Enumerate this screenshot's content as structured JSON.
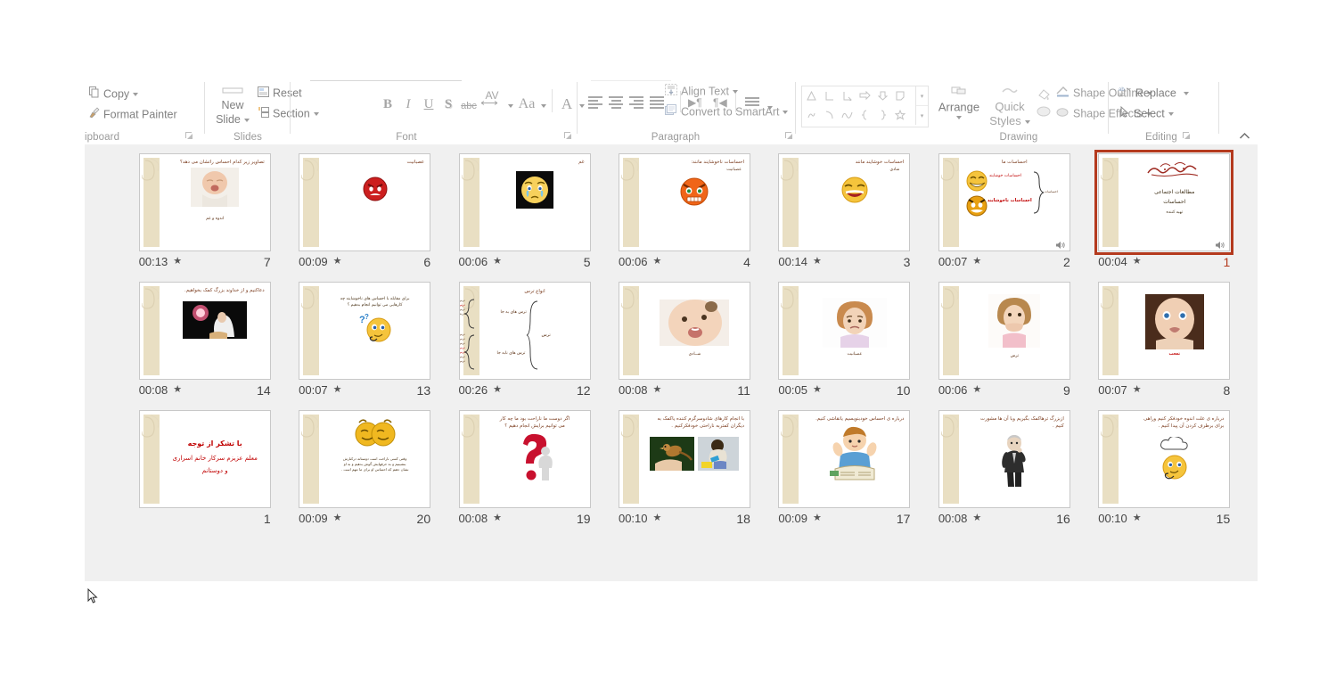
{
  "app": {
    "name": "PowerPoint Slide Sorter"
  },
  "ribbon": {
    "groups": [
      {
        "id": "clipboard",
        "label": "ipboard",
        "items": [
          {
            "name": "copy-button",
            "label": "Copy",
            "icon": "copy-icon",
            "caret": true
          },
          {
            "name": "format-painter-button",
            "label": "Format Painter",
            "icon": "format-painter-icon",
            "caret": false
          }
        ],
        "has_launcher": true
      },
      {
        "id": "slides",
        "label": "Slides",
        "items": [
          {
            "name": "new-slide-button",
            "label": "New\nSlide",
            "icon": "new-slide-icon",
            "caret": true
          },
          {
            "name": "reset-button",
            "label": "Reset",
            "icon": "reset-icon",
            "caret": false
          },
          {
            "name": "section-button",
            "label": "Section",
            "icon": "section-icon",
            "caret": true
          }
        ],
        "has_launcher": false
      },
      {
        "id": "font",
        "label": "Font",
        "items": [
          {
            "name": "bold-button",
            "label": "B"
          },
          {
            "name": "italic-button",
            "label": "I"
          },
          {
            "name": "underline-button",
            "label": "U"
          },
          {
            "name": "text-shadow-button",
            "label": "S"
          },
          {
            "name": "strikethrough-button",
            "label": "abc"
          },
          {
            "name": "character-spacing-button",
            "label": "AV",
            "caret": true
          },
          {
            "name": "change-case-button",
            "label": "Aa",
            "caret": true
          },
          {
            "name": "font-color-button",
            "label": "A",
            "caret": true
          }
        ],
        "has_launcher": true
      },
      {
        "id": "paragraph",
        "label": "Paragraph",
        "items": [
          {
            "name": "align-left-button",
            "label": ""
          },
          {
            "name": "align-center-button",
            "label": ""
          },
          {
            "name": "align-right-button",
            "label": ""
          },
          {
            "name": "justify-button",
            "label": "",
            "caret": true
          },
          {
            "name": "text-direction-ltr-button",
            "label": "▶¶"
          },
          {
            "name": "text-direction-rtl-button",
            "label": "¶◀"
          },
          {
            "name": "columns-button",
            "label": "",
            "caret": true
          },
          {
            "name": "align-text-button",
            "label": "Align Text",
            "icon": "align-text-icon",
            "caret": true
          },
          {
            "name": "convert-to-smartart-button",
            "label": "Convert to SmartArt",
            "icon": "smartart-icon",
            "caret": true
          }
        ],
        "has_launcher": true
      },
      {
        "id": "drawing",
        "label": "Drawing",
        "items": [
          {
            "name": "shapes-gallery",
            "label": ""
          },
          {
            "name": "arrange-button",
            "label": "Arrange",
            "icon": "arrange-icon",
            "caret": true
          },
          {
            "name": "quick-styles-button",
            "label": "Quick\nStyles",
            "icon": "quick-styles-icon",
            "caret": true
          },
          {
            "name": "shape-fill-button",
            "label": "",
            "icon": "shape-fill-icon"
          },
          {
            "name": "shape-outline-button",
            "label": "Shape Outline",
            "icon": "shape-outline-icon",
            "caret": true
          },
          {
            "name": "shape-effects-button",
            "label": "Shape Effects",
            "icon": "shape-effects-icon",
            "caret": true
          }
        ],
        "has_launcher": true
      },
      {
        "id": "editing",
        "label": "Editing",
        "items": [
          {
            "name": "replace-button",
            "label": "Replace",
            "icon": "replace-icon",
            "caret": true
          },
          {
            "name": "select-button",
            "label": "Select",
            "icon": "select-pointer-icon",
            "caret": true
          }
        ],
        "has_launcher": false
      }
    ],
    "collapse_icon": "chevron-up-icon"
  },
  "slides": [
    {
      "number": "7",
      "time": "00:13",
      "star": "★",
      "title": "تصاویر زیر کدام احساس راتشان می دهد؟",
      "caption": "اندوه و غم",
      "art": "photo-crying-baby",
      "selected": false
    },
    {
      "number": "6",
      "time": "00:09",
      "star": "★",
      "title": "عصبانیت",
      "caption": "",
      "art": "emoji-angry-red",
      "selected": false
    },
    {
      "number": "5",
      "time": "00:06",
      "star": "★",
      "title": "غم",
      "caption": "",
      "art": "emoji-crying-black",
      "selected": false
    },
    {
      "number": "4",
      "time": "00:06",
      "star": "★",
      "title": "احساسات ناخوشایند مانند:",
      "caption": "عصبانیت",
      "art": "emoji-angry-orange",
      "selected": false
    },
    {
      "number": "3",
      "time": "00:14",
      "star": "★",
      "title": "احساسات خوشایند مانند",
      "caption": "شادی",
      "art": "emoji-laughing",
      "selected": false
    },
    {
      "number": "2",
      "time": "00:07",
      "star": "★",
      "title": "احساسات ما",
      "caption": "",
      "art": "diagram-feelings",
      "labels": {
        "happy": "احساسات خوشایند",
        "unhappy": "احساسات ناخوشایند",
        "brace": "احساسات"
      },
      "selected": false
    },
    {
      "number": "1",
      "time": "00:04",
      "star": "★",
      "title": "بسم الله الرحمن الرحیم",
      "lines": [
        "مطالعات اجتماعی",
        "احساسات",
        "تهیه کننده"
      ],
      "art": "bismillah",
      "selected": true
    },
    {
      "number": "14",
      "time": "00:08",
      "star": "★",
      "title": "دعاکنیم و از خداوند بزرگ کمک بخواهیم.",
      "caption": "",
      "art": "photo-praying-girl",
      "selected": false
    },
    {
      "number": "13",
      "time": "00:07",
      "star": "★",
      "title": "",
      "body": "برای مقابله با  احساس های ناخوشایند چه\nکارهایی می توانیم انجام بدهیم ؟",
      "art": "emoji-thinking",
      "selected": false
    },
    {
      "number": "12",
      "time": "00:26",
      "star": "★",
      "title": "انواع ترس",
      "art": "diagram-fear",
      "labels": {
        "good": "ترس های به جا",
        "bad": "ترس های نابه جا",
        "root": "ترس"
      },
      "selected": false
    },
    {
      "number": "11",
      "time": "00:08",
      "star": "★",
      "title": "",
      "caption": "شــادی",
      "art": "photo-laughing-baby",
      "selected": false
    },
    {
      "number": "10",
      "time": "00:05",
      "star": "★",
      "title": "",
      "caption": "عصبانیت",
      "art": "photo-angry-girl",
      "selected": false
    },
    {
      "number": "9",
      "time": "00:06",
      "star": "★",
      "title": "",
      "caption": "ترس",
      "art": "photo-scared-girl",
      "selected": false
    },
    {
      "number": "8",
      "time": "00:07",
      "star": "★",
      "title": "",
      "caption": "تعجب",
      "art": "photo-surprised-baby",
      "selected": false
    },
    {
      "number": "1",
      "time": "",
      "star": "",
      "title": "با تشکر از توجه",
      "lines": [
        "معلم عزیزم سرکار خانم اسراری",
        "و دوستانم"
      ],
      "art": "thanks",
      "selected": false
    },
    {
      "number": "20",
      "time": "00:09",
      "star": "★",
      "title": "",
      "body": "وقتی کسی ناراحت است دوستانه درکنارش\nبنشینیم و به حرفهایش گوش بدهیم و به او\nنشان دهیم که احساس او برای ما مهم است .",
      "art": "emoji-two-friends",
      "selected": false
    },
    {
      "number": "19",
      "time": "00:08",
      "star": "★",
      "title": "اگر دوست ما ناراحت بود ما چه کار\nمی توانیم برایش انجام دهیم ؟",
      "art": "photo-question-mark",
      "selected": false
    },
    {
      "number": "18",
      "time": "00:10",
      "star": "★",
      "title": "با انجام کارهای شادوسرگرم کننده یاکمک به\nدیگران کمتربه ناراحتی خودفکرکنیم .",
      "art": "photo-bird-and-child",
      "selected": false
    },
    {
      "number": "17",
      "time": "00:09",
      "star": "★",
      "title": "درباره ی احساس خودبنویسیم یانقاشی کنیم.",
      "art": "clipart-boy-writing",
      "selected": false
    },
    {
      "number": "16",
      "time": "00:08",
      "star": "★",
      "title": "ازبزرگ ترهاکمک بگیریم وبا آن ها مشورت\nکنیم .",
      "art": "clipart-old-man",
      "selected": false
    },
    {
      "number": "15",
      "time": "00:10",
      "star": "★",
      "title": "درباره ی علت اندوه خودفکر کنیم وراهی\nبرای برطرف کردن آن پیدا کنیم .",
      "art": "emoji-thought-bubble",
      "selected": false
    }
  ],
  "colors": {
    "selection": "#b43a1e",
    "pane_bg": "#f0f0f0",
    "ribbon_text": "#808080",
    "slide_band": "#e9dfc3",
    "title_brown": "#7a3b1d",
    "accent_red": "#c00000"
  }
}
